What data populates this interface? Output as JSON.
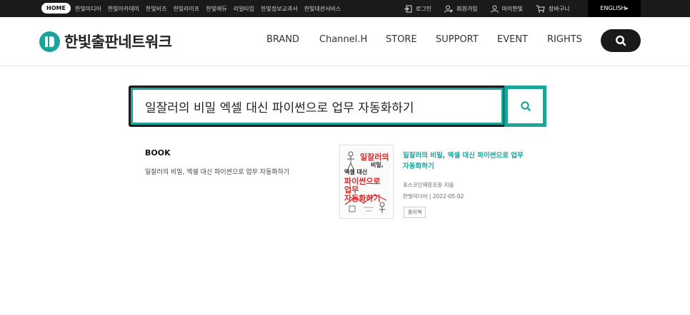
{
  "topbar": {
    "home": "HOME",
    "family_links": [
      "한빛미디어",
      "한빛아카데미",
      "한빛비즈",
      "한빛라이프",
      "한빛에듀",
      "리얼타임",
      "한빛정보교과서",
      "한빛대관서비스"
    ],
    "login": "로그인",
    "signup": "회원가입",
    "mypage": "마이한빛",
    "cart": "장바구니",
    "english": "ENGLISH▸"
  },
  "header": {
    "logo_text": "한빛출판네트워크",
    "nav": [
      "BRAND",
      "Channel.H",
      "STORE",
      "SUPPORT",
      "EVENT",
      "RIGHTS"
    ]
  },
  "search": {
    "value": "일잘러의 비밀 엑셀 대신 파이썬으로 업무 자동화하기"
  },
  "results": {
    "section_label": "BOOK",
    "query_text": "일잘러의 비밀, 엑셀 대신 파이썬으로 업무 자동화하기",
    "book": {
      "cover_lines": [
        "일잘러의",
        "비밀,",
        "엑셀 대신",
        "파이썬으로",
        "업무",
        "자동화하기"
      ],
      "title": "일잘러의 비밀, 엑셀 대신 파이썬으로 업무 자동화하기",
      "author": "포스코인재창조원 지음",
      "publisher": "한빛미디어",
      "date": "2022-05-02",
      "format": "종이책"
    }
  },
  "colors": {
    "accent": "#1ba39c",
    "dark": "#1a1a1a"
  }
}
